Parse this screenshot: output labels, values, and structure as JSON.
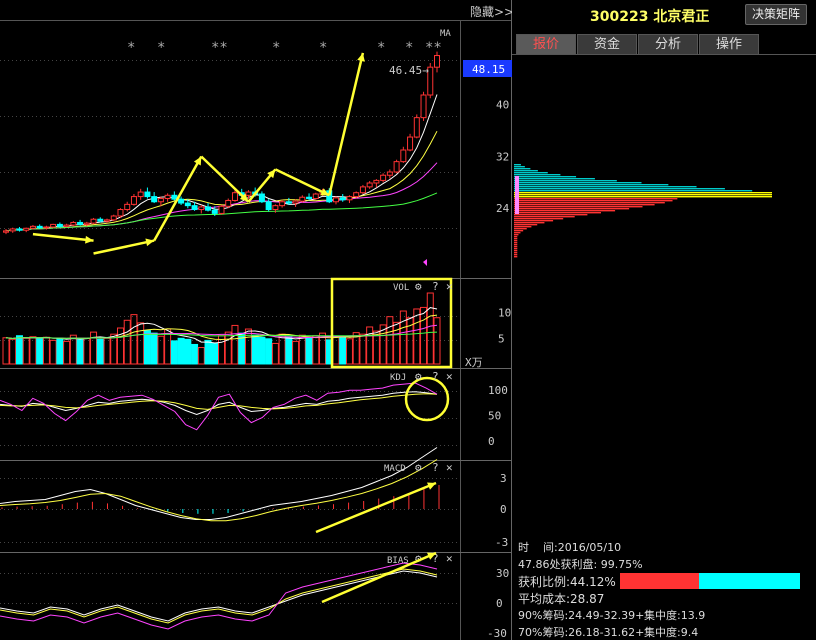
{
  "header": {
    "hide_label": "隐藏>>",
    "stock": "300223 北京君正",
    "decision_button": "决策矩阵"
  },
  "tabs": [
    {
      "label": "报价",
      "active": true
    },
    {
      "label": "资金",
      "active": false
    },
    {
      "label": "分析",
      "active": false
    },
    {
      "label": "操作",
      "active": false
    }
  ],
  "price_panel": {
    "ma_label": "MA",
    "current_price": "48.15",
    "high_label": "46.45→",
    "y_ticks": [
      "40",
      "32",
      "24"
    ],
    "stars": [
      "*",
      "*",
      "**",
      "*",
      "*",
      "*",
      "*",
      "**"
    ]
  },
  "vol_panel": {
    "label": "VOL",
    "y_ticks": [
      "10",
      "5"
    ],
    "unit": "X万"
  },
  "kdj_panel": {
    "label": "KDJ",
    "y_ticks": [
      "100",
      "50",
      "0"
    ]
  },
  "macd_panel": {
    "label": "MACD",
    "y_ticks": [
      "3",
      "0",
      "-3"
    ]
  },
  "bias_panel": {
    "label": "BIAS",
    "y_ticks": [
      "30",
      "0",
      "-30"
    ]
  },
  "panel_icons": {
    "gear": "⚙",
    "help": "?",
    "close": "✕"
  },
  "cost_distribution": {
    "y_ticks": [
      "32",
      "24"
    ],
    "time_label": "时",
    "date_label": "间:2016/05/10",
    "profit_at": "47.86处获利盘: 99.75%",
    "profit_ratio": "获利比例:44.12%",
    "avg_cost": "平均成本:28.87",
    "chip90": "90%筹码:24.49-32.39+",
    "chip90_conc": "集中度:13.9",
    "chip70": "70%筹码:26.18-31.62+",
    "chip70_conc": "集中度:9.4",
    "profit_bar_fraction": 0.44,
    "colors": {
      "profit": "#ff3333",
      "loss": "#00ffff"
    }
  },
  "chart_data": {
    "type": "candlestick",
    "price_ylim": [
      16,
      50
    ],
    "candles": [
      [
        20.3,
        20.8,
        20.0,
        20.5
      ],
      [
        20.5,
        21.0,
        20.2,
        20.8
      ],
      [
        20.8,
        21.1,
        20.4,
        20.6
      ],
      [
        20.6,
        21.0,
        20.3,
        20.9
      ],
      [
        20.9,
        21.4,
        20.7,
        21.2
      ],
      [
        21.2,
        21.5,
        20.8,
        21.0
      ],
      [
        21.0,
        21.3,
        20.7,
        21.1
      ],
      [
        21.1,
        21.6,
        20.9,
        21.5
      ],
      [
        21.5,
        21.8,
        21.0,
        21.2
      ],
      [
        21.2,
        21.6,
        21.0,
        21.4
      ],
      [
        21.4,
        22.0,
        21.2,
        21.8
      ],
      [
        21.8,
        22.2,
        21.3,
        21.5
      ],
      [
        21.5,
        21.9,
        21.2,
        21.7
      ],
      [
        21.7,
        22.5,
        21.5,
        22.3
      ],
      [
        22.3,
        22.6,
        21.8,
        22.0
      ],
      [
        22.0,
        22.4,
        21.7,
        22.2
      ],
      [
        22.2,
        23.0,
        22.0,
        22.8
      ],
      [
        22.8,
        24.0,
        22.5,
        23.8
      ],
      [
        23.8,
        25.0,
        23.5,
        24.6
      ],
      [
        24.6,
        26.2,
        24.4,
        25.8
      ],
      [
        25.8,
        27.0,
        25.3,
        26.5
      ],
      [
        26.5,
        27.2,
        25.5,
        25.8
      ],
      [
        25.8,
        26.5,
        24.8,
        25.0
      ],
      [
        25.0,
        25.8,
        24.3,
        25.5
      ],
      [
        25.5,
        26.3,
        25.0,
        26.0
      ],
      [
        26.0,
        26.6,
        25.2,
        25.4
      ],
      [
        25.4,
        25.8,
        24.5,
        24.8
      ],
      [
        24.8,
        25.4,
        24.0,
        24.4
      ],
      [
        24.4,
        25.0,
        23.6,
        23.8
      ],
      [
        23.8,
        24.5,
        23.2,
        24.2
      ],
      [
        24.2,
        24.8,
        23.5,
        23.7
      ],
      [
        23.7,
        24.3,
        22.8,
        23.2
      ],
      [
        23.2,
        24.5,
        23.0,
        24.3
      ],
      [
        24.3,
        25.5,
        24.0,
        25.2
      ],
      [
        25.2,
        26.8,
        25.0,
        26.4
      ],
      [
        26.4,
        27.0,
        25.6,
        26.0
      ],
      [
        26.0,
        26.8,
        25.4,
        26.5
      ],
      [
        26.5,
        27.2,
        25.8,
        26.2
      ],
      [
        26.2,
        26.6,
        24.8,
        25.0
      ],
      [
        25.0,
        25.4,
        23.5,
        23.8
      ],
      [
        23.8,
        24.6,
        23.3,
        24.4
      ],
      [
        24.4,
        25.3,
        24.1,
        25.0
      ],
      [
        25.0,
        25.6,
        24.5,
        24.8
      ],
      [
        24.8,
        25.4,
        24.2,
        25.1
      ],
      [
        25.1,
        26.0,
        24.9,
        25.7
      ],
      [
        25.7,
        26.3,
        25.2,
        25.5
      ],
      [
        25.5,
        26.4,
        25.3,
        26.2
      ],
      [
        26.2,
        27.0,
        25.9,
        26.7
      ],
      [
        26.7,
        27.1,
        24.8,
        25.0
      ],
      [
        25.0,
        25.8,
        24.6,
        25.6
      ],
      [
        25.6,
        26.2,
        25.0,
        25.3
      ],
      [
        25.3,
        26.0,
        24.8,
        25.8
      ],
      [
        25.8,
        26.6,
        25.5,
        26.4
      ],
      [
        26.4,
        27.6,
        26.2,
        27.3
      ],
      [
        27.3,
        28.2,
        27.0,
        27.9
      ],
      [
        27.9,
        28.5,
        27.2,
        28.3
      ],
      [
        28.3,
        29.4,
        28.0,
        29.1
      ],
      [
        29.1,
        30.0,
        28.6,
        29.6
      ],
      [
        29.6,
        31.5,
        29.4,
        31.2
      ],
      [
        31.2,
        33.5,
        31.0,
        33.0
      ],
      [
        33.0,
        35.5,
        32.8,
        35.0
      ],
      [
        35.0,
        38.5,
        34.8,
        38.0
      ],
      [
        38.0,
        42.0,
        37.5,
        41.5
      ],
      [
        41.5,
        46.45,
        41.0,
        45.8
      ],
      [
        45.8,
        48.2,
        45.0,
        47.6
      ]
    ],
    "vol": [
      5.1,
      4.8,
      5.5,
      5.0,
      5.3,
      4.9,
      5.2,
      4.6,
      5.0,
      4.4,
      5.6,
      4.7,
      5.0,
      6.2,
      4.8,
      5.0,
      5.8,
      7.0,
      8.5,
      9.6,
      8.0,
      6.5,
      6.0,
      5.4,
      6.8,
      4.5,
      5.0,
      4.8,
      3.8,
      3.2,
      4.6,
      4.0,
      5.5,
      6.2,
      7.5,
      6.0,
      6.8,
      5.6,
      5.2,
      4.9,
      4.0,
      5.8,
      5.3,
      4.4,
      5.6,
      5.0,
      5.5,
      6.0,
      4.7,
      5.2,
      5.4,
      4.9,
      6.1,
      5.8,
      7.2,
      6.4,
      7.6,
      9.2,
      8.1,
      10.3,
      9.0,
      10.7,
      11.0,
      13.8,
      9.0
    ],
    "kdj": {
      "k": [
        72,
        70,
        68,
        74,
        72,
        66,
        60,
        64,
        70,
        76,
        74,
        78,
        80,
        82,
        80,
        76,
        70,
        60,
        52,
        60,
        72,
        76,
        66,
        58,
        60,
        64,
        66,
        70,
        74,
        72,
        78,
        80,
        84,
        86,
        88,
        90,
        94,
        96,
        97,
        95,
        92
      ],
      "d": [
        70,
        69,
        69,
        70,
        71,
        69,
        66,
        65,
        67,
        70,
        72,
        74,
        76,
        78,
        79,
        78,
        75,
        70,
        64,
        62,
        66,
        70,
        69,
        66,
        64,
        63,
        64,
        66,
        69,
        70,
        73,
        75,
        78,
        81,
        83,
        85,
        88,
        90,
        92,
        93,
        92
      ],
      "j": [
        80,
        72,
        60,
        84,
        74,
        54,
        40,
        58,
        80,
        90,
        80,
        86,
        88,
        90,
        82,
        70,
        58,
        32,
        22,
        50,
        86,
        92,
        56,
        36,
        46,
        66,
        72,
        84,
        90,
        80,
        94,
        96,
        100,
        100,
        102,
        104,
        110,
        112,
        114,
        104,
        92
      ]
    },
    "macd": [
      0.2,
      0.3,
      0.35,
      0.4,
      0.6,
      0.8,
      0.9,
      0.7,
      0.4,
      0.1,
      -0.1,
      -0.3,
      -0.5,
      -0.6,
      -0.6,
      -0.5,
      -0.3,
      -0.1,
      0.1,
      0.2,
      0.3,
      0.45,
      0.6,
      0.8,
      1.0,
      1.3,
      1.6,
      2.0,
      2.5,
      3.0
    ],
    "bias": [
      -5,
      -8,
      -10,
      -4,
      -6,
      -12,
      -6,
      -2,
      -8,
      -14,
      -18,
      -10,
      -6,
      -4,
      -8,
      -10,
      -4,
      2,
      8,
      12,
      16,
      20,
      24,
      28,
      32,
      30,
      26
    ]
  }
}
